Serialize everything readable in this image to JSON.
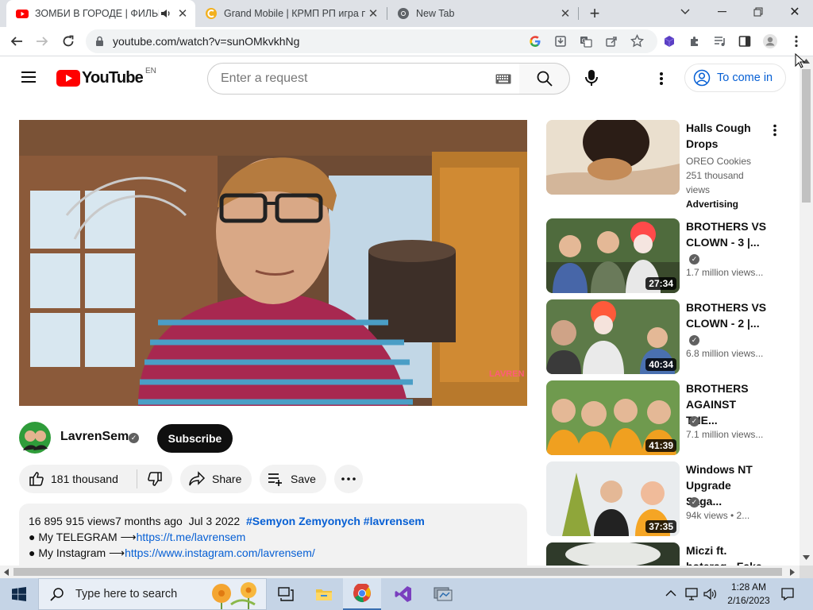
{
  "browser": {
    "tabs": [
      {
        "title": "ЗОМБИ В ГОРОДЕ | ФИЛЬМ",
        "active": true
      },
      {
        "title": "Grand Mobile | КРМП РП игра п",
        "active": false
      },
      {
        "title": "New Tab",
        "active": false
      }
    ],
    "new_tab": "+",
    "url": "youtube.com/watch?v=sunOMkvkhNg"
  },
  "youtube": {
    "logo_text": "YouTube",
    "region": "EN",
    "search_placeholder": "Enter a request",
    "sign_in": "To come in",
    "channel": {
      "name": "LavrenSem",
      "subscribe": "Subscribe"
    },
    "actions": {
      "likes": "181 thousand",
      "share": "Share",
      "save": "Save"
    },
    "video_watermark": "LAVREN SEM",
    "description": {
      "views": "16 895 915 views",
      "age": "7 months ago",
      "date": "Jul 3 2022",
      "hashtags": "#Semyon Zemyonych #lavrensem",
      "line1_label": "● My TELEGRAM ⟶",
      "line1_link": "https://t.me/lavrensem",
      "line2_label": "● My Instagram ⟶",
      "line2_link": "https://www.instagram.com/lavrensem/"
    },
    "recommendations": [
      {
        "title": "Halls Cough Drops",
        "channel": "OREO Cookies",
        "views": "251 thousand views",
        "badge": "Advertising",
        "duration": ""
      },
      {
        "title": "BROTHERS VS CLOWN - 3 |...",
        "views": "1.7 million views...",
        "duration": "27:34"
      },
      {
        "title": "BROTHERS VS CLOWN - 2 |...",
        "views": "6.8 million views...",
        "duration": "40:34"
      },
      {
        "title": "BROTHERS AGAINST THE...",
        "views": "7.1 million views...",
        "duration": "41:39"
      },
      {
        "title": "Windows NT Upgrade Saga...",
        "views": "94k views  • 2...",
        "duration": "37:35"
      },
      {
        "title": "Miczi ft. hoteraq - Fake",
        "views": "",
        "duration": ""
      }
    ]
  },
  "taskbar": {
    "search_placeholder": "Type here to search",
    "time": "1:28 AM",
    "date": "2/16/2023"
  }
}
